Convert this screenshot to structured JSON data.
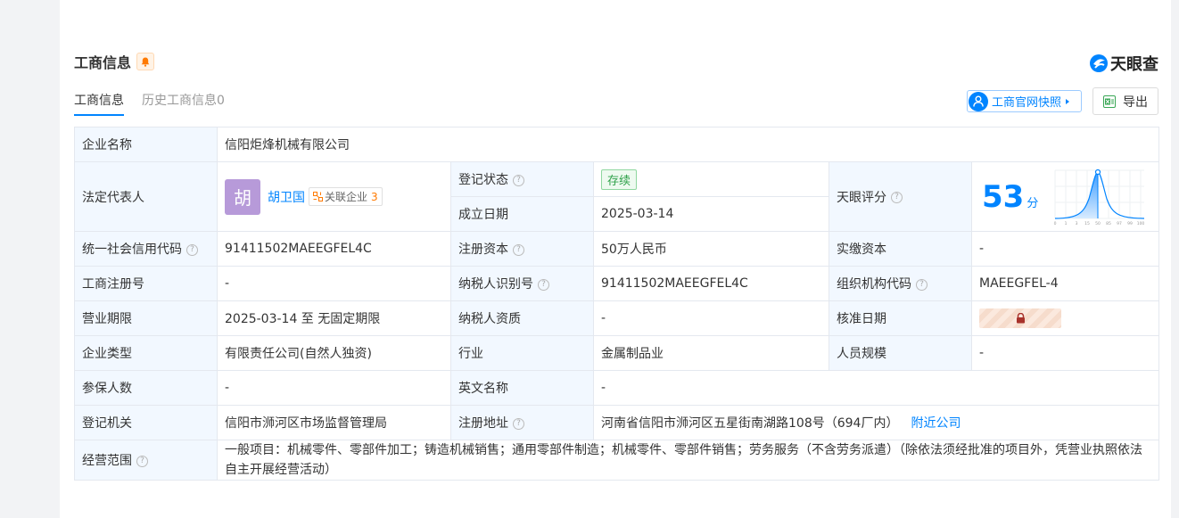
{
  "section": {
    "title": "工商信息",
    "logo_text": "天眼查"
  },
  "tabs": [
    {
      "label": "工商信息"
    },
    {
      "label": "历史工商信息0"
    }
  ],
  "actions": {
    "snapshot_label": "工商官网快照",
    "export_label": "导出"
  },
  "colors": {
    "accent": "#0084ff",
    "label_bg": "#f2f8ff",
    "status_green": "#2fa14a"
  },
  "labels": {
    "company_name": "企业名称",
    "legal_rep": "法定代表人",
    "reg_status": "登记状态",
    "established": "成立日期",
    "tianyan_score": "天眼评分",
    "credit_code": "统一社会信用代码",
    "reg_capital": "注册资本",
    "paid_capital": "实缴资本",
    "reg_number": "工商注册号",
    "taxpayer_id": "纳税人识别号",
    "org_code": "组织机构代码",
    "business_term": "营业期限",
    "taxpayer_qual": "纳税人资质",
    "approval_date": "核准日期",
    "company_type": "企业类型",
    "industry": "行业",
    "staff_size": "人员规模",
    "insured": "参保人数",
    "english_name": "英文名称",
    "authority": "登记机关",
    "reg_address": "注册地址",
    "scope": "经营范围"
  },
  "values": {
    "company_name": "信阳炬烽机械有限公司",
    "legal_rep_avatar": "胡",
    "legal_rep_name": "胡卫国",
    "related_label": "关联企业",
    "related_count": "3",
    "reg_status": "存续",
    "established": "2025-03-14",
    "tianyan_score": "53",
    "score_unit": "分",
    "credit_code": "91411502MAEEGFEL4C",
    "reg_capital": "50万人民币",
    "paid_capital": "-",
    "reg_number": "-",
    "taxpayer_id": "91411502MAEEGFEL4C",
    "org_code": "MAEEGFEL-4",
    "business_term": "2025-03-14 至 无固定期限",
    "taxpayer_qual": "-",
    "company_type": "有限责任公司(自然人独资)",
    "industry": "金属制品业",
    "staff_size": "-",
    "insured": "-",
    "english_name": "-",
    "authority": "信阳市浉河区市场监督管理局",
    "reg_address": "河南省信阳市浉河区五星街南湖路108号（694厂内）",
    "nearby_link": "附近公司",
    "scope": "一般项目：机械零件、零部件加工；铸造机械销售；通用零部件制造；机械零件、零部件销售；劳务服务（不含劳务派遣）（除依法须经批准的项目外，凭营业执照依法自主开展经营活动）"
  },
  "score_chart": {
    "x_ticks": [
      "0",
      "1",
      "3",
      "15",
      "50",
      "85",
      "97",
      "99",
      "100"
    ],
    "score_percentile": 50
  }
}
